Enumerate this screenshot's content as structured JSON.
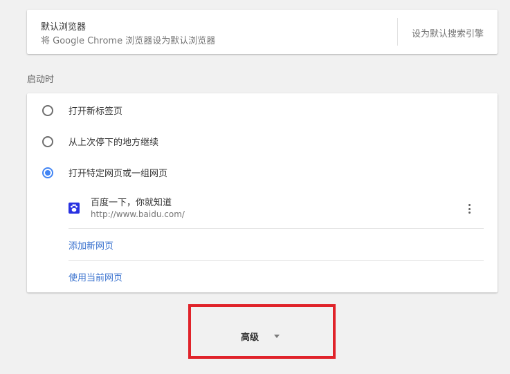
{
  "default_browser": {
    "title": "默认浏览器",
    "subtitle": "将 Google Chrome 浏览器设为默认浏览器",
    "button_label": "设为默认搜索引擎"
  },
  "startup": {
    "section_title": "启动时",
    "options": [
      {
        "label": "打开新标签页",
        "selected": false
      },
      {
        "label": "从上次停下的地方继续",
        "selected": false
      },
      {
        "label": "打开特定网页或一组网页",
        "selected": true
      }
    ],
    "pages": [
      {
        "name": "百度一下，你就知道",
        "url": "http://www.baidu.com/",
        "icon": "baidu-paw-icon"
      }
    ],
    "add_page_label": "添加新网页",
    "use_current_label": "使用当前网页"
  },
  "advanced": {
    "label": "高级",
    "highlight_color": "#e0232a"
  },
  "colors": {
    "accent": "#4285f4",
    "link": "#3b73cf",
    "background": "#f1f1f1"
  }
}
